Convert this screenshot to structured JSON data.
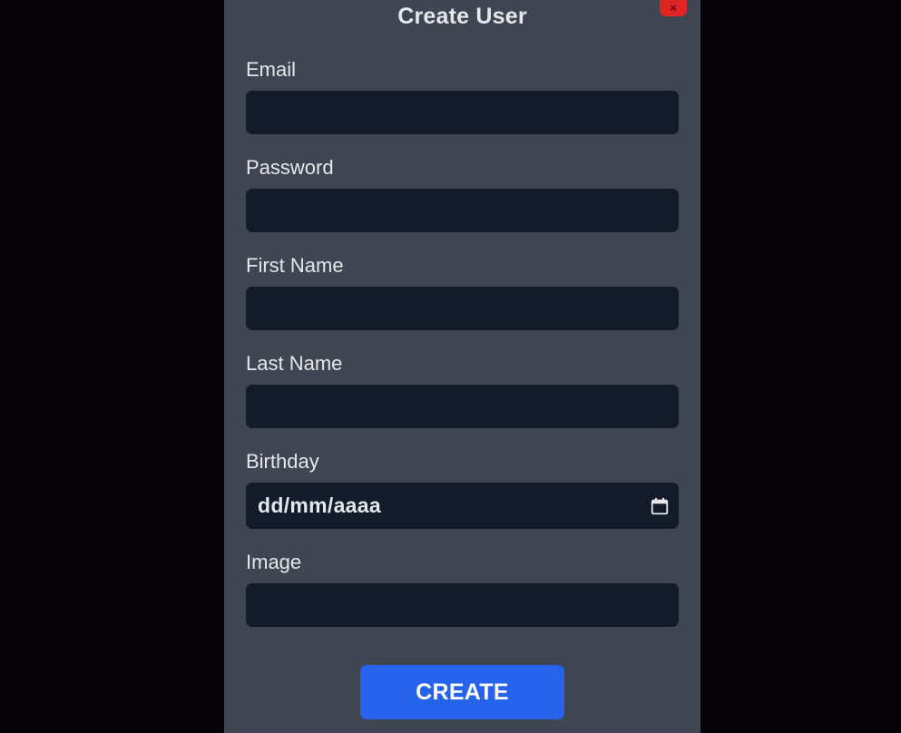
{
  "modal": {
    "title": "Create User",
    "close_icon": "x-icon",
    "close_symbol": "×"
  },
  "form": {
    "email": {
      "label": "Email",
      "value": ""
    },
    "password": {
      "label": "Password",
      "value": ""
    },
    "first_name": {
      "label": "First Name",
      "value": ""
    },
    "last_name": {
      "label": "Last Name",
      "value": ""
    },
    "birthday": {
      "label": "Birthday",
      "placeholder": "dd/mm/aaaa",
      "icon": "calendar-icon"
    },
    "image": {
      "label": "Image",
      "value": ""
    }
  },
  "actions": {
    "create_label": "CREATE"
  },
  "colors": {
    "backdrop": "#050208",
    "modal_bg": "#3f4652",
    "input_bg": "#131a2a",
    "accent": "#2563eb",
    "close_bg": "#e02424",
    "text": "#e5e7eb"
  }
}
